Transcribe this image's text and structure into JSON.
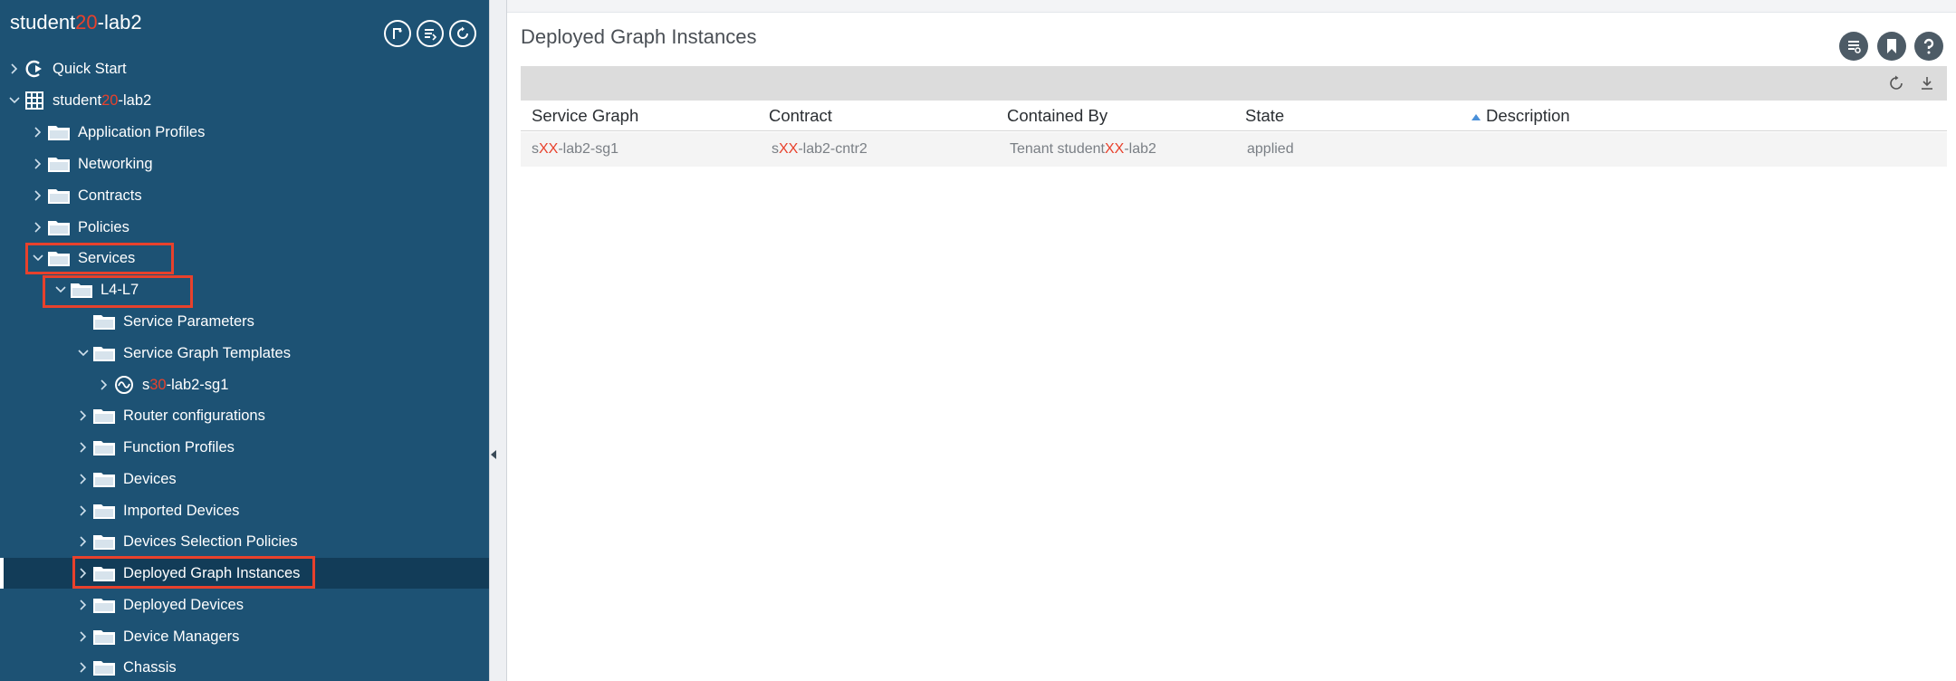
{
  "sidebar": {
    "title_parts": [
      "student",
      "20",
      "-lab2"
    ],
    "header_buttons": [
      {
        "name": "pin-icon",
        "glyph": "⌜"
      },
      {
        "name": "collapse-list-icon",
        "glyph": "☰"
      },
      {
        "name": "refresh-icon",
        "glyph": "↻"
      }
    ],
    "tree": [
      {
        "label": "Quick Start"
      },
      {
        "label_parts": [
          "student",
          "20",
          "-lab2"
        ]
      },
      {
        "label": "Application Profiles"
      },
      {
        "label": "Networking"
      },
      {
        "label": "Contracts"
      },
      {
        "label": "Policies"
      },
      {
        "label": "Services"
      },
      {
        "label": "L4-L7"
      },
      {
        "label": "Service Parameters"
      },
      {
        "label": "Service Graph Templates"
      },
      {
        "label_parts": [
          "s",
          "30",
          "-lab2-sg1"
        ]
      },
      {
        "label": "Router configurations"
      },
      {
        "label": "Function Profiles"
      },
      {
        "label": "Devices"
      },
      {
        "label": "Imported Devices"
      },
      {
        "label": "Devices Selection Policies"
      },
      {
        "label": "Deployed Graph Instances"
      },
      {
        "label": "Deployed Devices"
      },
      {
        "label": "Device Managers"
      },
      {
        "label": "Chassis"
      }
    ]
  },
  "main": {
    "title": "Deployed Graph Instances",
    "header_icons": [
      "table-settings-icon",
      "bookmark-icon",
      "help-icon"
    ],
    "toolbar_icons": [
      "refresh-icon",
      "download-icon"
    ],
    "columns": [
      "Service Graph",
      "Contract",
      "Contained By",
      "State",
      "Description"
    ],
    "sorted_column": "Description",
    "rows": [
      {
        "service_graph": [
          "s",
          "XX",
          "-lab2-sg1"
        ],
        "contract": [
          "s",
          "XX",
          "-lab2-cntr2"
        ],
        "contained_by": [
          "Tenant student",
          "XX",
          "-lab2"
        ],
        "state": "applied",
        "description": ""
      }
    ]
  },
  "colors": {
    "sidebar_bg": "#1d5274",
    "selected_row_bg": "#123c58",
    "highlight_box": "#e8412c",
    "redaction": "#e8412c"
  }
}
